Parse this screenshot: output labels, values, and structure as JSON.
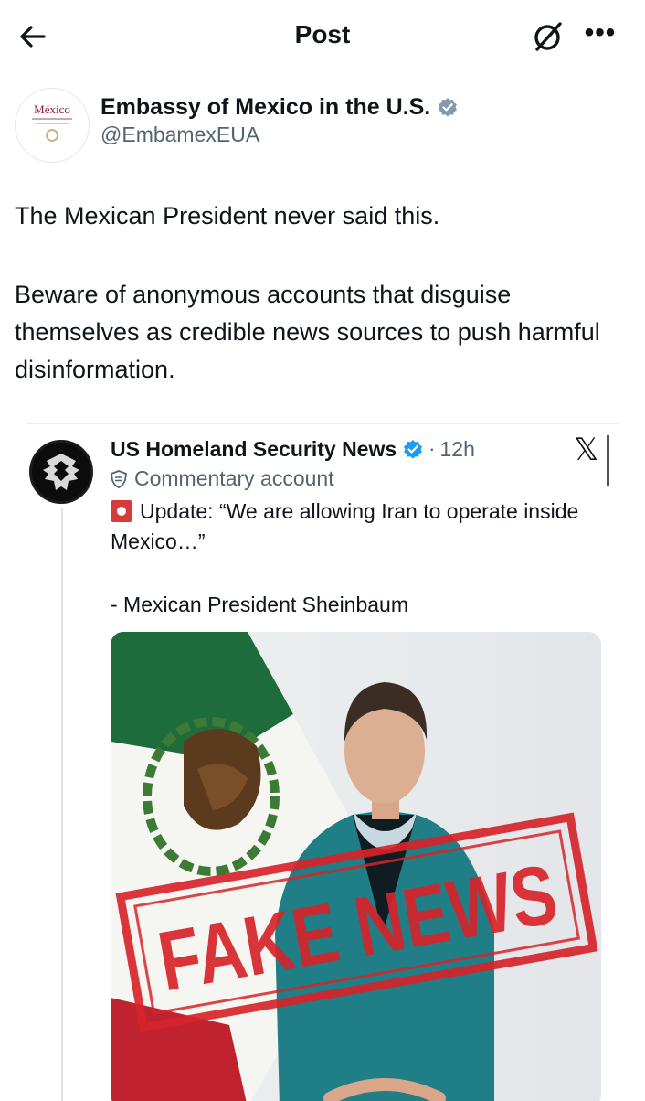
{
  "header": {
    "title": "Post",
    "more_label": "•••"
  },
  "post": {
    "avatar_text": "México",
    "author_name": "Embassy of Mexico in the U.S.",
    "author_handle": "@EmbamexEUA",
    "paragraphs": [
      "The Mexican President never said this.",
      "Beware of anonymous accounts that disguise themselves as credible news sources to push harmful disinformation."
    ]
  },
  "quoted": {
    "author_name": "US Homeland Security News",
    "separator": "·",
    "time": "12h",
    "platform_glyph": "𝕏",
    "label": "Commentary account",
    "text": "Update: “We are allowing Iran to operate inside Mexico…”",
    "signature": "- Mexican President Sheinbaum",
    "stamp_text": "FAKE NEWS"
  },
  "colors": {
    "verified_badge": "#829aab",
    "stamp_red": "#d6242a",
    "suit_teal": "#1f7e86",
    "flag_green": "#1e6b3c",
    "flag_red": "#c0232f"
  }
}
